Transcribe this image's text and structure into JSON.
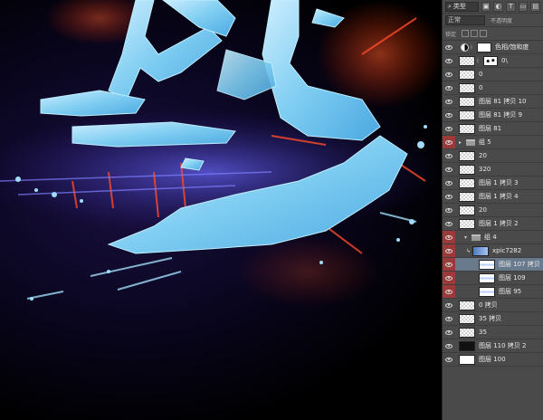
{
  "layers_panel": {
    "filter_label": "类型",
    "filter_icons": [
      "image-filter-icon",
      "adjustment-filter-icon",
      "type-filter-icon",
      "shape-filter-icon",
      "smart-object-filter-icon"
    ],
    "filter_icon_glyphs": [
      "▣",
      "◐",
      "T",
      "▭",
      "▤"
    ],
    "blend_mode": "正常",
    "opacity_label": "不透明度",
    "lock_label": "锁定",
    "layers": [
      {
        "name": "色相/饱和度",
        "type": "adjustment",
        "eye": "normal"
      },
      {
        "name": "0\\",
        "type": "masked",
        "eye": "normal"
      },
      {
        "name": "0",
        "type": "layer",
        "eye": "normal"
      },
      {
        "name": "0",
        "type": "layer",
        "eye": "normal"
      },
      {
        "name": "图层 81 拷贝 10",
        "type": "layer",
        "eye": "normal"
      },
      {
        "name": "图层 81 拷贝 9",
        "type": "layer",
        "eye": "normal"
      },
      {
        "name": "图层 81",
        "type": "layer",
        "eye": "normal"
      },
      {
        "name": "组 5",
        "type": "group",
        "eye": "red"
      },
      {
        "name": "20",
        "type": "layer",
        "eye": "normal"
      },
      {
        "name": "320",
        "type": "layer",
        "eye": "normal"
      },
      {
        "name": "图层 1 拷贝 3",
        "type": "layer",
        "eye": "normal"
      },
      {
        "name": "图层 1 拷贝 4",
        "type": "layer",
        "eye": "normal"
      },
      {
        "name": "20",
        "type": "layer",
        "eye": "normal"
      },
      {
        "name": "图层 1 拷贝 2",
        "type": "layer",
        "eye": "normal"
      },
      {
        "name": "组 4",
        "type": "group-open",
        "eye": "red"
      },
      {
        "name": "xpic7282",
        "type": "clipped",
        "eye": "red"
      },
      {
        "name": "图层 107 拷贝",
        "type": "sub",
        "eye": "red",
        "selected": true
      },
      {
        "name": "图层 109",
        "type": "sub",
        "eye": "red"
      },
      {
        "name": "图层 95",
        "type": "sub",
        "eye": "red"
      },
      {
        "name": "0 拷贝",
        "type": "layer",
        "eye": "normal"
      },
      {
        "name": "35 拷贝",
        "type": "layer",
        "eye": "normal"
      },
      {
        "name": "35",
        "type": "layer",
        "eye": "normal"
      },
      {
        "name": "图层 110 拷贝 2",
        "type": "layer-dark",
        "eye": "normal"
      },
      {
        "name": "图层 100",
        "type": "layer-white",
        "eye": "normal"
      }
    ]
  },
  "colors": {
    "panel_bg": "#4a4a4a",
    "selected_row": "#6a7a8d",
    "eye_red": "#9c3a3a",
    "ice_blue": "#8fd6f5",
    "glow_red": "#ff3a1a"
  }
}
